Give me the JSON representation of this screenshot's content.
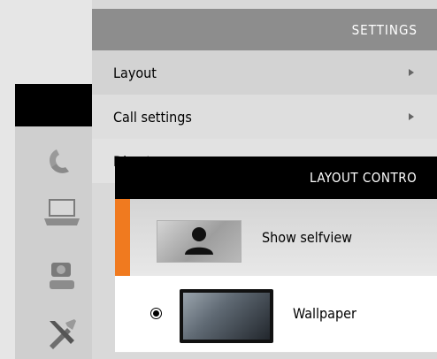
{
  "settings": {
    "title": "SETTINGS",
    "items": [
      {
        "label": "Layout"
      },
      {
        "label": "Call settings"
      },
      {
        "label": "Directory"
      }
    ]
  },
  "layout_control": {
    "title": "LAYOUT CONTRO",
    "options": [
      {
        "label": "Show selfview",
        "icon": "person-silhouette-icon",
        "active": true
      },
      {
        "label": "Wallpaper",
        "icon": "tv-wallpaper-icon",
        "selected": true
      }
    ]
  },
  "sidebar": {
    "icons": [
      "phone-icon",
      "laptop-icon",
      "camera-icon",
      "tools-icon"
    ]
  },
  "colors": {
    "accent": "#f07a1f",
    "settings_header": "#8d8d8d",
    "layout_header": "#000000"
  }
}
